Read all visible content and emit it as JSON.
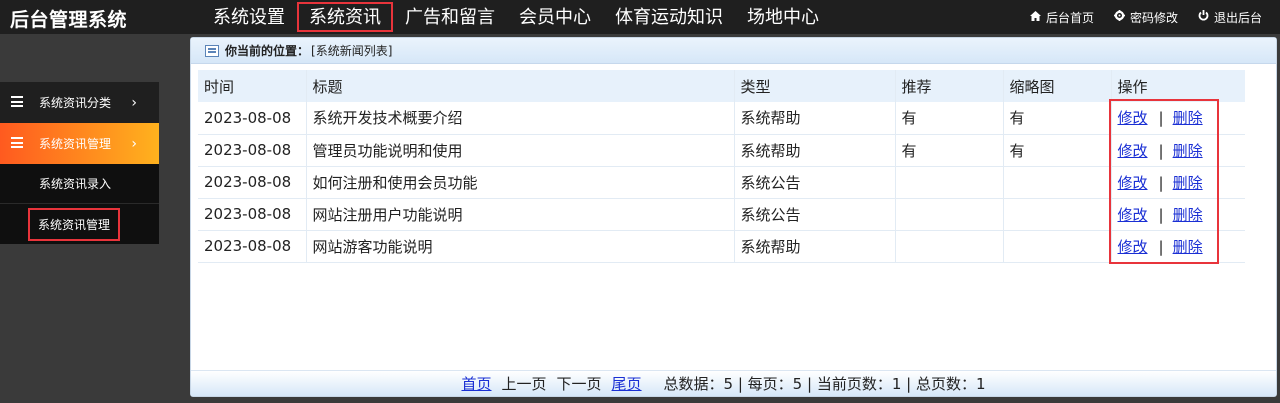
{
  "app": {
    "brand": "后台管理系统"
  },
  "nav": {
    "items": [
      {
        "label": "系统设置"
      },
      {
        "label": "系统资讯"
      },
      {
        "label": "广告和留言"
      },
      {
        "label": "会员中心"
      },
      {
        "label": "体育运动知识"
      },
      {
        "label": "场地中心"
      }
    ],
    "active": "系统资讯"
  },
  "top_links": [
    {
      "icon": "home-icon",
      "label": "后台首页"
    },
    {
      "icon": "gear-icon",
      "label": "密码修改"
    },
    {
      "icon": "power-icon",
      "label": "退出后台"
    }
  ],
  "sidebar": {
    "groups": [
      {
        "label": "系统资讯分类",
        "chevron": "›"
      },
      {
        "label": "系统资讯管理",
        "chevron": "›"
      }
    ],
    "sub_items": [
      {
        "label": "系统资讯录入"
      },
      {
        "label": "系统资讯管理"
      }
    ]
  },
  "breadcrumb": {
    "prefix": "你当前的位置：",
    "location": "[系统新闻列表]"
  },
  "table": {
    "columns": [
      "时间",
      "标题",
      "类型",
      "推荐",
      "缩略图",
      "操作"
    ],
    "rows": [
      {
        "time": "2023-08-08",
        "title": "系统开发技术概要介绍",
        "type": "系统帮助",
        "recommend": "有",
        "thumb": "有"
      },
      {
        "time": "2023-08-08",
        "title": "管理员功能说明和使用",
        "type": "系统帮助",
        "recommend": "有",
        "thumb": "有"
      },
      {
        "time": "2023-08-08",
        "title": "如何注册和使用会员功能",
        "type": "系统公告",
        "recommend": "",
        "thumb": ""
      },
      {
        "time": "2023-08-08",
        "title": "网站注册用户功能说明",
        "type": "系统公告",
        "recommend": "",
        "thumb": ""
      },
      {
        "time": "2023-08-08",
        "title": "网站游客功能说明",
        "type": "系统帮助",
        "recommend": "",
        "thumb": ""
      }
    ],
    "actions": {
      "edit": "修改",
      "separator": "|",
      "delete": "删除"
    }
  },
  "pager": {
    "first": "首页",
    "prev": "上一页",
    "next": "下一页",
    "last": "尾页",
    "stats": "总数据：5 | 每页：5 | 当前页数：1 | 总页数：1"
  },
  "colors": {
    "topbar": "#1f1f1f",
    "active_orange_start": "#ff5a1f",
    "active_orange_end": "#ffb21e",
    "highlight": "#e8343b",
    "link": "#1a2fd4"
  }
}
